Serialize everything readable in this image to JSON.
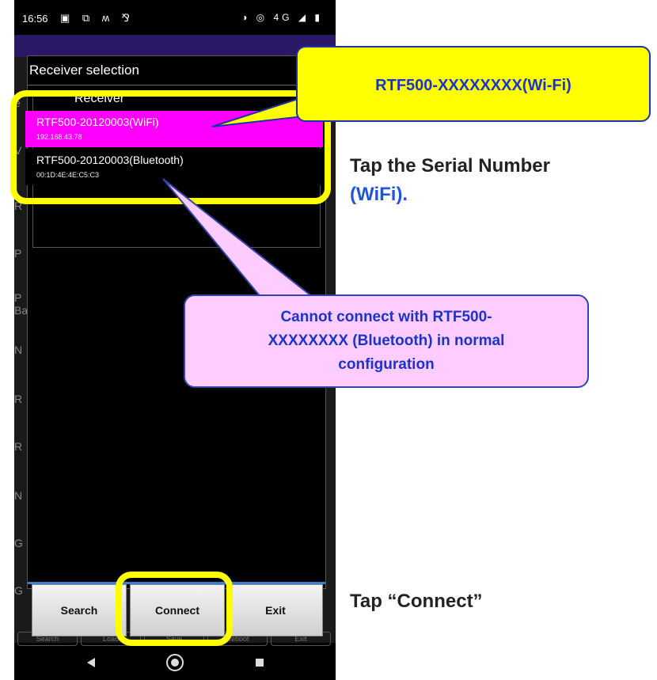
{
  "status_bar": {
    "time": "16:56",
    "left_icons": "▣ ⧉ ʍ ⅋",
    "right_icons": "◑ ◎ 4G ◢ ▮"
  },
  "dialog": {
    "title": "Receiver selection",
    "list_header": "Receiver",
    "items": [
      {
        "name": "RTF500-20120003(WiFi)",
        "detail": "192.168.43.78",
        "selected": true
      },
      {
        "name": "RTF500-20120003(Bluetooth)",
        "detail": "00:1D:4E:4E:C5:C3",
        "selected": false
      }
    ]
  },
  "buttons": {
    "search": "Search",
    "connect": "Connect",
    "exit": "Exit"
  },
  "background_tabs": [
    "Search",
    "Load",
    "Save",
    "Reboot",
    "Exit"
  ],
  "background_rows": [
    "e",
    "V",
    "R",
    "P",
    "P",
    "Ba",
    "N",
    "R",
    "R",
    "N",
    "G",
    "G"
  ],
  "callouts": {
    "wifi": "RTF500-XXXXXXXX(Wi-Fi)",
    "bluetooth_line1": "Cannot connect with RTF500-",
    "bluetooth_line2": "XXXXXXXX (Bluetooth) in normal",
    "bluetooth_line3": "configuration"
  },
  "side_notes": {
    "tap_serial_a": "Tap the Serial Number",
    "tap_serial_open": "(",
    "tap_serial_wifi": "WiFi",
    "tap_serial_close": ").",
    "tap_connect": "Tap “Connect”"
  },
  "colors": {
    "highlight": "#ffff00",
    "selected_item": "#ff00ff",
    "callout_text": "#1a33cc"
  }
}
